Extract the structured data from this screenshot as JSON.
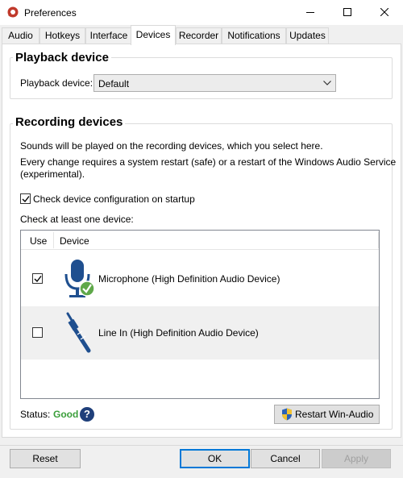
{
  "window": {
    "title": "Preferences"
  },
  "tabs": [
    {
      "label": "Audio"
    },
    {
      "label": "Hotkeys"
    },
    {
      "label": "Interface"
    },
    {
      "label": "Devices",
      "active": true
    },
    {
      "label": "Recorder"
    },
    {
      "label": "Notifications"
    },
    {
      "label": "Updates"
    }
  ],
  "playback": {
    "group_title": "Playback device",
    "label": "Playback device:",
    "selected": "Default"
  },
  "recording": {
    "group_title": "Recording devices",
    "info1": "Sounds will be played on the recording devices, which you select here.",
    "info2_line1": "Every change requires a system restart (safe) or a restart of the Windows Audio Service",
    "info2_line2": "(experimental).",
    "check_config_label": "Check device configuration on startup",
    "check_config_checked": true,
    "list_hint": "Check at least one device:",
    "columns": {
      "use": "Use",
      "device": "Device"
    },
    "devices": [
      {
        "name": "Microphone (High Definition Audio Device)",
        "checked": true,
        "icon": "microphone-icon"
      },
      {
        "name": "Line In (High Definition Audio Device)",
        "checked": false,
        "icon": "audio-jack-icon"
      }
    ],
    "status_label": "Status:",
    "status_value": "Good",
    "restart_button": "Restart Win-Audio"
  },
  "footer": {
    "reset": "Reset",
    "ok": "OK",
    "cancel": "Cancel",
    "apply": "Apply"
  },
  "colors": {
    "status_good": "#3a9e3a",
    "accent": "#0078d7",
    "icon_blue": "#1f4f8f"
  }
}
